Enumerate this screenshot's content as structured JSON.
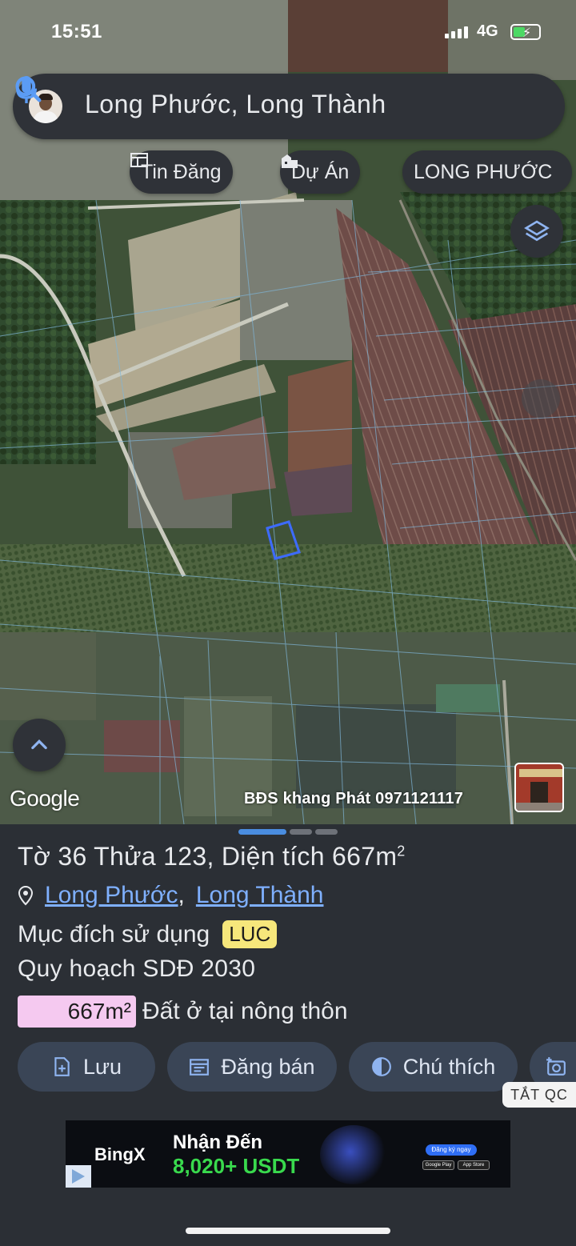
{
  "status_bar": {
    "time": "15:51",
    "network": "4G"
  },
  "search": {
    "query": "Long Phước, Long Thành"
  },
  "chips": [
    {
      "label": "Tin Đăng",
      "icon": "listing-icon"
    },
    {
      "label": "Dự Án",
      "icon": "building-icon"
    },
    {
      "label": "LONG PHƯỚC",
      "icon": ""
    }
  ],
  "map": {
    "google_label": "Google",
    "watermark": "BĐS khang Phát 0971121117"
  },
  "parcel": {
    "title_prefix": "Tờ",
    "sheet_number": "36",
    "title_mid": "Thửa",
    "plot_number": "123",
    "area_label": "Diện tích",
    "area_value": "667m",
    "area_unit_sup": "2",
    "location_ward": "Long Phước",
    "location_separator": ",",
    "location_district": "Long Thành",
    "purpose_label": "Mục đích sử dụng",
    "purpose_code": "LUC",
    "plan_label": "Quy hoạch SDĐ 2030",
    "zone_area": "667m²",
    "zone_type": "Đất ở tại nông thôn"
  },
  "actions": [
    {
      "label": "Lưu",
      "icon": "bookmark-add-icon"
    },
    {
      "label": "Đăng bán",
      "icon": "calendar-listing-icon"
    },
    {
      "label": "Chú thích",
      "icon": "contrast-icon"
    }
  ],
  "ad": {
    "close_label": "TẮT QC",
    "brand": "BingX",
    "headline1": "Nhận Đến",
    "headline2": "8,020+ USDT",
    "cta": "Đăng ký ngay",
    "store1": "Google Play",
    "store2": "App Store"
  },
  "colors": {
    "sheet_bg": "#2b2f35",
    "link": "#7fb0ff",
    "purpose_badge": "#f6e77b",
    "zone_area_bg": "#f5c9f0",
    "action_bg": "#3a4556",
    "parcel_highlight": "#3d6bff"
  }
}
